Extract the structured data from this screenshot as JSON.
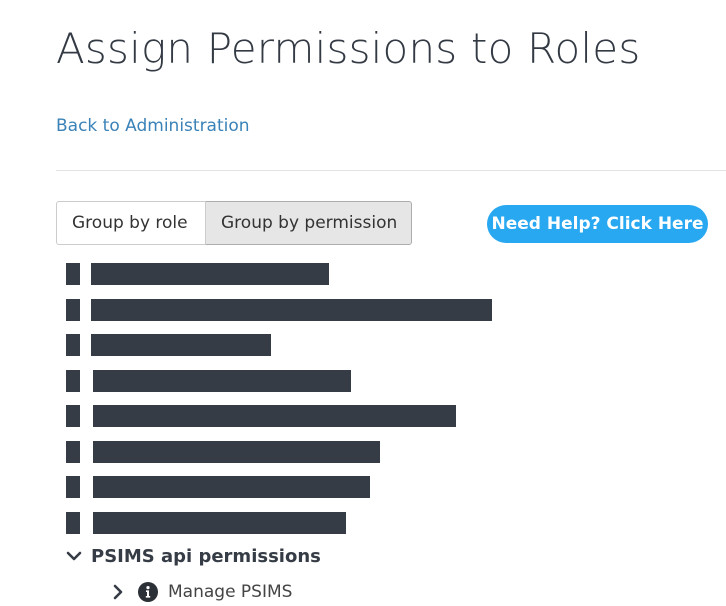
{
  "page": {
    "title": "Assign Permissions to Roles",
    "back_link": "Back to Administration"
  },
  "view_toggle": {
    "options": [
      "Group by role",
      "Group by permission"
    ],
    "selected": "Group by permission"
  },
  "help_button": {
    "label": "Need Help? Click Here",
    "color": "#29a8f2"
  },
  "redacted_color": "#363c45",
  "permission_group": {
    "label": "PSIMS api permissions",
    "expanded": true,
    "items": [
      {
        "label": "Manage PSIMS",
        "icon": "info-circle-icon",
        "expanded": false
      }
    ]
  }
}
